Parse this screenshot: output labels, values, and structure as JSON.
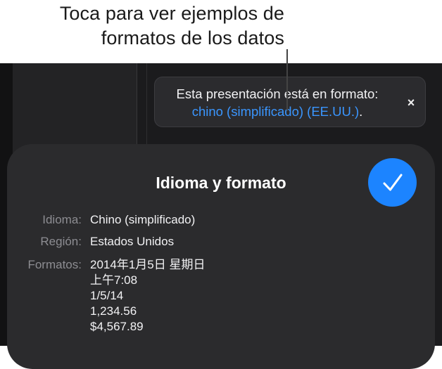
{
  "callout": {
    "line1": "Toca para ver ejemplos de",
    "line2": "formatos de los datos"
  },
  "banner": {
    "text": "Esta presentación está en formato:",
    "link": "chino (simplificado) (EE.UU.)",
    "period": ".",
    "close_icon": "×"
  },
  "sheet": {
    "title": "Idioma y formato",
    "done_icon": "checkmark-icon",
    "rows": {
      "language": {
        "label": "Idioma:",
        "value": "Chino (simplificado)"
      },
      "region": {
        "label": "Región:",
        "value": "Estados Unidos"
      },
      "formats": {
        "label": "Formatos:",
        "values": [
          "2014年1月5日 星期日",
          "上午7:08",
          "1/5/14",
          "1,234.56",
          "$4,567.89"
        ]
      }
    }
  },
  "colors": {
    "accent": "#1c84ff",
    "link": "#3a96ff",
    "background": "#1b1b1d",
    "sheet": "#2b2b2d"
  }
}
